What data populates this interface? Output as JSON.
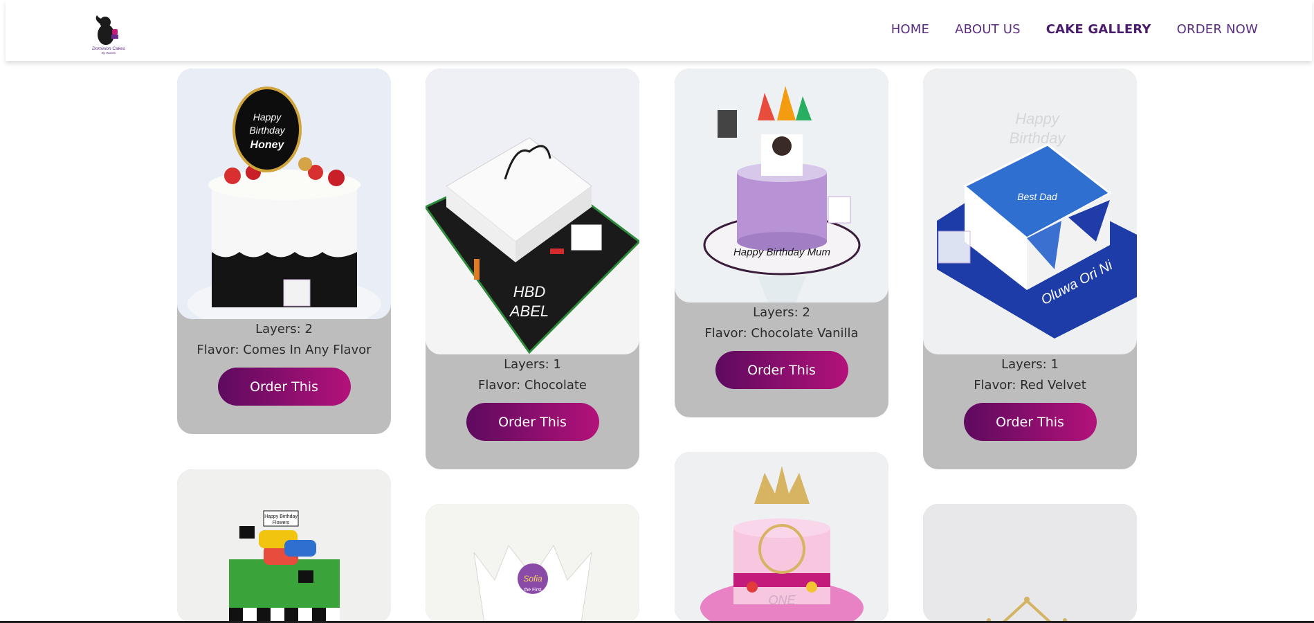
{
  "logo": {
    "brand_text": "Dominion Cakes",
    "brand_sub": "By Wunmi"
  },
  "nav": [
    {
      "label": "HOME"
    },
    {
      "label": "ABOUT US"
    },
    {
      "label": "CAKE GALLERY",
      "active": true
    },
    {
      "label": "ORDER NOW"
    }
  ],
  "gallery": {
    "button_label": "Order This",
    "cards": [
      {
        "layers": "Layers: 2",
        "flavor": "Flavor: Comes In Any Flavor",
        "cake_text": [
          "Happy",
          "Birthday",
          "Honey"
        ]
      },
      {
        "layers": "Layers: 1",
        "flavor": "Flavor: Chocolate",
        "cake_text": [
          "HBD",
          "ABEL"
        ]
      },
      {
        "layers": "Layers: 2",
        "flavor": "Flavor: Chocolate Vanilla",
        "cake_text": [
          "Happy Birthday Mum"
        ]
      },
      {
        "layers": "Layers: 1",
        "flavor": "Flavor: Red Velvet",
        "cake_text": [
          "Happy",
          "Birthday",
          "Best Dad",
          "Oluwa Ori Ni"
        ]
      },
      {
        "cake_text": [
          "Happy Birthday",
          "Flowers"
        ]
      },
      {
        "cake_text": [
          "Sofia",
          "the First"
        ]
      },
      {
        "cake_text": [
          "ONE"
        ]
      },
      {
        "cake_text": []
      }
    ]
  },
  "colors": {
    "nav": "#5a2d82",
    "button_start": "#5e0a5f",
    "button_end": "#b3127a",
    "card_bg": "#bebdbe"
  }
}
